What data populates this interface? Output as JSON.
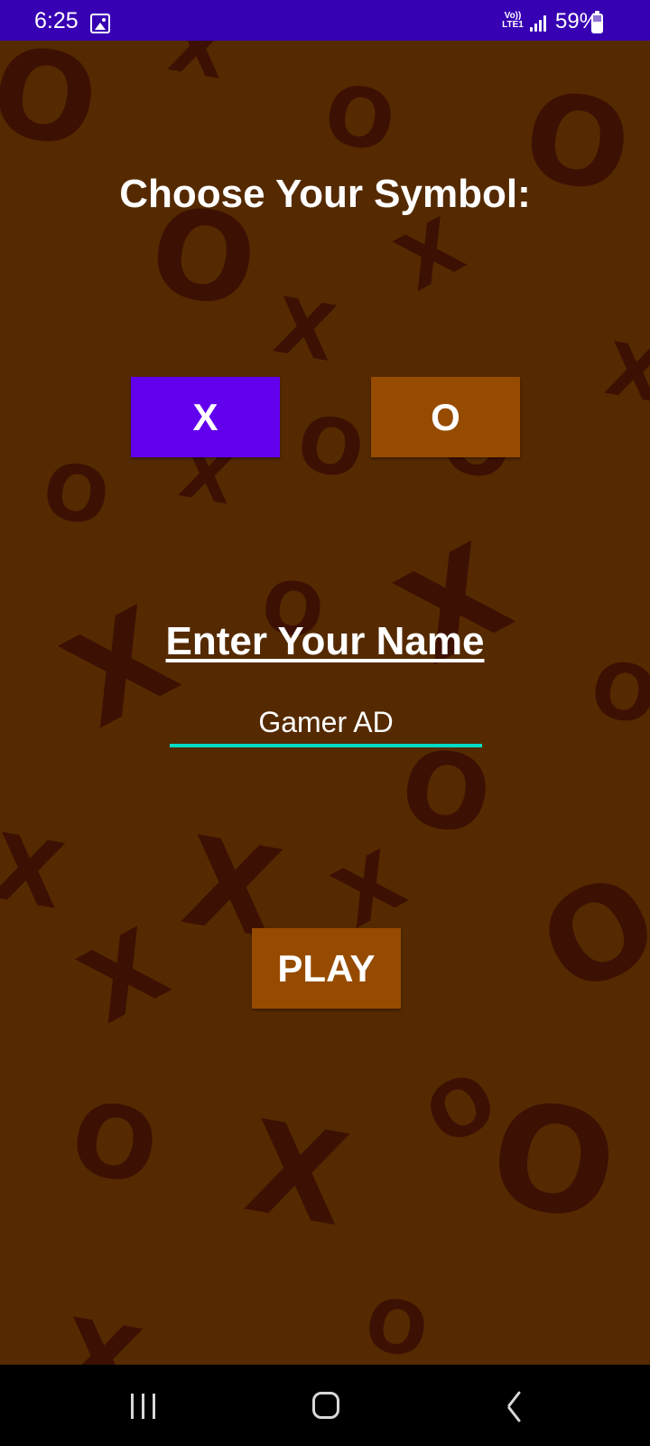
{
  "status_bar": {
    "time": "6:25",
    "network": "Vo)) LTE1",
    "battery_percent": "59%",
    "icons": [
      "gallery-icon",
      "signal-icon",
      "battery-icon"
    ]
  },
  "game": {
    "choose_title": "Choose Your Symbol:",
    "symbol_x": "X",
    "symbol_o": "O",
    "name_label": "Enter Your Name",
    "name_value": "Gamer AD",
    "play_label": "PLAY"
  },
  "background_marks": [
    "O",
    "X",
    "O",
    "O",
    "O",
    "X",
    "X",
    "X",
    "O",
    "X",
    "O",
    "O",
    "X",
    "X",
    "O",
    "O",
    "O",
    "X",
    "X",
    "X",
    "O",
    "X",
    "O",
    "O",
    "X",
    "O",
    "X",
    "O"
  ],
  "colors": {
    "status_bar": "#3700B3",
    "background": "#552A00",
    "deco_marks": "#3D1004",
    "selected_symbol": "#6200EE",
    "button": "#964B00",
    "input_underline": "#03DAC5"
  },
  "nav_bar": {
    "icons": [
      "recent-apps-icon",
      "home-icon",
      "back-icon"
    ]
  }
}
